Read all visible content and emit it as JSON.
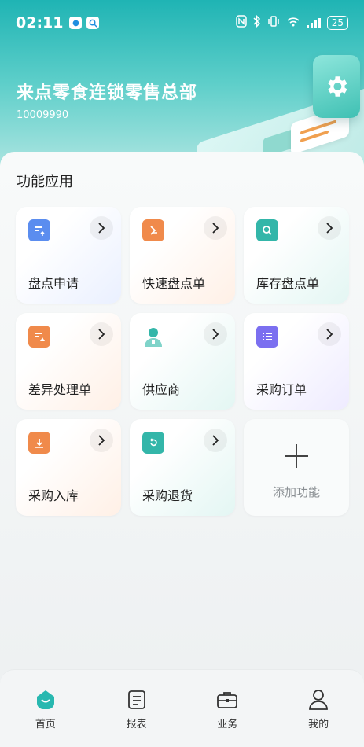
{
  "status_bar": {
    "time": "02:11",
    "battery": "25"
  },
  "header": {
    "company_name": "来点零食连锁零售总部",
    "company_id": "10009990"
  },
  "section": {
    "title": "功能应用"
  },
  "tiles": [
    {
      "label": "盘点申请",
      "icon": "document-upload-icon",
      "color": "#5b8def"
    },
    {
      "label": "快速盘点单",
      "icon": "quick-check-icon",
      "color": "#f08a4b"
    },
    {
      "label": "库存盘点单",
      "icon": "search-box-icon",
      "color": "#33b6a9"
    },
    {
      "label": "差异处理单",
      "icon": "warning-document-icon",
      "color": "#f08a4b"
    },
    {
      "label": "供应商",
      "icon": "supplier-person-icon",
      "color": "#33b6a9"
    },
    {
      "label": "采购订单",
      "icon": "list-icon",
      "color": "#7b6ff0"
    },
    {
      "label": "采购入库",
      "icon": "inbound-box-icon",
      "color": "#f08a4b"
    },
    {
      "label": "采购退货",
      "icon": "return-box-icon",
      "color": "#33b6a9"
    }
  ],
  "add_tile": {
    "label": "添加功能"
  },
  "bottom_nav": [
    {
      "label": "首页",
      "icon": "home-icon",
      "active": true
    },
    {
      "label": "报表",
      "icon": "report-icon",
      "active": false
    },
    {
      "label": "业务",
      "icon": "briefcase-icon",
      "active": false
    },
    {
      "label": "我的",
      "icon": "profile-icon",
      "active": false
    }
  ],
  "colors": {
    "accent": "#1fb4b4",
    "text": "#222222"
  }
}
